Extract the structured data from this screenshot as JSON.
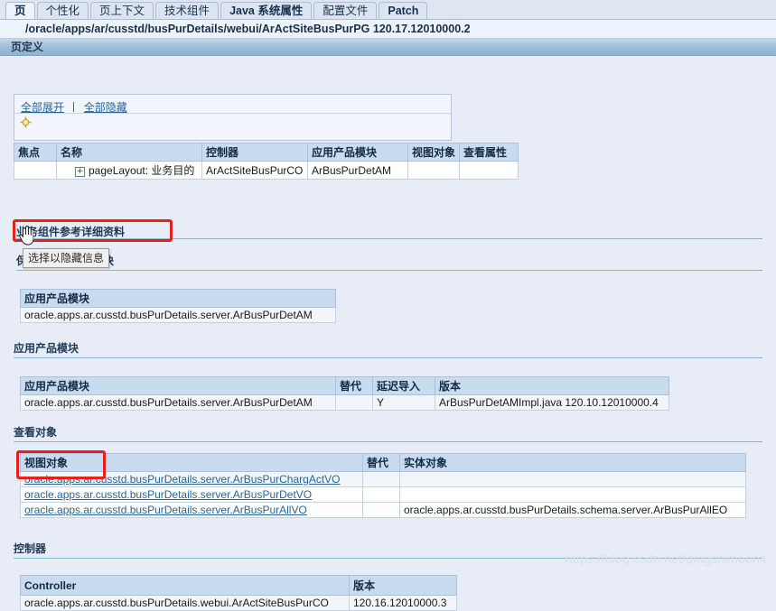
{
  "tabs": [
    {
      "label": "页",
      "active": true,
      "bold": true
    },
    {
      "label": "个性化",
      "active": false,
      "bold": false
    },
    {
      "label": "页上下文",
      "active": false,
      "bold": false
    },
    {
      "label": "技术组件",
      "active": false,
      "bold": false
    },
    {
      "label": "Java 系统属性",
      "active": false,
      "bold": true
    },
    {
      "label": "配置文件",
      "active": false,
      "bold": false
    },
    {
      "label": "Patch",
      "active": false,
      "bold": true
    }
  ],
  "path": "/oracle/apps/ar/cusstd/busPurDetails/webui/ArActSiteBusPurPG 120.17.12010000.2",
  "pagedef_title": "页定义",
  "expand_panel": {
    "expand_all": "全部展开",
    "collapse_all": "全部隐藏",
    "focus_icon": "focus-target-icon"
  },
  "tree_table": {
    "headers": [
      "焦点",
      "名称",
      "控制器",
      "应用产品模块",
      "视图对象",
      "查看属性"
    ],
    "rows": [
      {
        "focus": "",
        "name": "pageLayout: 业务目的",
        "controller": "ArActSiteBusPurCO",
        "module": "ArBusPurDetAM",
        "view_object": "",
        "view_attr": ""
      }
    ]
  },
  "sections": {
    "bc_reference": "业务组件参考详细资料",
    "retained_module": "保留的应用产品模块",
    "app_module": "应用产品模块",
    "view_objects": "查看对象",
    "controller": "控制器"
  },
  "tooltip": "选择以隐藏信息",
  "retained_module_table": {
    "headers": [
      "应用产品模块"
    ],
    "rows": [
      [
        "oracle.apps.ar.cusstd.busPurDetails.server.ArBusPurDetAM"
      ]
    ]
  },
  "app_module_table": {
    "headers": [
      "应用产品模块",
      "替代",
      "延迟导入",
      "版本"
    ],
    "rows": [
      [
        "oracle.apps.ar.cusstd.busPurDetails.server.ArBusPurDetAM",
        "",
        "Y",
        "ArBusPurDetAMImpl.java 120.10.12010000.4"
      ]
    ]
  },
  "view_object_table": {
    "headers": [
      "视图对象",
      "替代",
      "实体对象"
    ],
    "rows": [
      [
        "oracle.apps.ar.cusstd.busPurDetails.server.ArBusPurChargActVO",
        "",
        ""
      ],
      [
        "oracle.apps.ar.cusstd.busPurDetails.server.ArBusPurDetVO",
        "",
        ""
      ],
      [
        "oracle.apps.ar.cusstd.busPurDetails.server.ArBusPurAllVO",
        "",
        "oracle.apps.ar.cusstd.busPurDetails.schema.server.ArBusPurAllEO"
      ]
    ]
  },
  "controller_table": {
    "headers": [
      "Controller",
      "版本"
    ],
    "rows": [
      [
        "oracle.apps.ar.cusstd.busPurDetails.webui.ArActSiteBusPurCO",
        "120.16.12010000.3"
      ]
    ]
  },
  "watermark": "https://blog.csdn.net/qingshimoon4",
  "colors": {
    "page_bg": "#e8ecf7",
    "tab_active": "#eef3fa",
    "header_bar": "#9dbcd8",
    "table_header": "#c9dbee",
    "link": "#2a6496",
    "annotation": "#e2231a"
  }
}
